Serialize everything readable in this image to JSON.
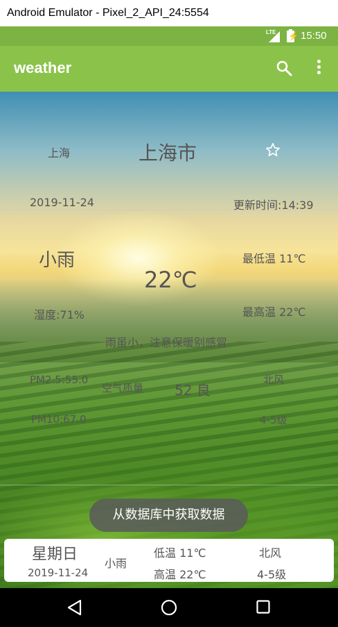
{
  "window": {
    "title": "Android Emulator - Pixel_2_API_24:5554"
  },
  "status_bar": {
    "network": "LTE",
    "time": "15:50"
  },
  "app_bar": {
    "title": "weather",
    "search_icon": "search-icon",
    "menu_icon": "more-vert-icon"
  },
  "city": {
    "short_name": "上海",
    "full_name": "上海市",
    "favorite_icon": "star-outline-icon"
  },
  "update": {
    "date": "2019-11-24",
    "update_time": "更新时间:14:39"
  },
  "weather": {
    "condition": "小雨",
    "temperature": "22℃",
    "low_temp": "最低温 11℃",
    "high_temp": "最高温 22℃",
    "humidity": "湿度:71%",
    "tip": "雨虽小，注意保暖别感冒"
  },
  "air": {
    "pm25": "PM2.5:55.0",
    "quality_label": "空气质量",
    "quality_value": "52 良",
    "wind_direction": "北风",
    "pm10": "PM10:67.0",
    "wind_level": "4-5级"
  },
  "toast": {
    "message": "从数据库中获取数据"
  },
  "forecast": {
    "day": "星期日",
    "date": "2019-11-24",
    "condition": "小雨",
    "low": "低温 11℃",
    "high": "高温 22℃",
    "wind_direction": "北风",
    "wind_level": "4-5级"
  },
  "colors": {
    "app_bar": "#8bc34a",
    "status_bar": "#7cb342",
    "toast_bg": "#5a5a5a"
  }
}
